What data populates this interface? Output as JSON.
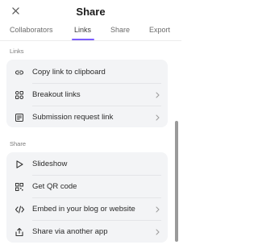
{
  "header": {
    "title": "Share",
    "close_icon": "close-icon"
  },
  "tabs": [
    {
      "label": "Collaborators",
      "active": false
    },
    {
      "label": "Links",
      "active": true
    },
    {
      "label": "Share",
      "active": false
    },
    {
      "label": "Export",
      "active": false
    }
  ],
  "accent_color": "#7c5cff",
  "links_section": {
    "label": "Links",
    "items": [
      {
        "label": "Copy link to clipboard",
        "icon": "link-icon",
        "has_chevron": false
      },
      {
        "label": "Breakout links",
        "icon": "breakout-grid-icon",
        "has_chevron": true
      },
      {
        "label": "Submission request link",
        "icon": "submission-form-icon",
        "has_chevron": true
      }
    ]
  },
  "share_section": {
    "label": "Share",
    "items": [
      {
        "label": "Slideshow",
        "icon": "play-icon",
        "has_chevron": false
      },
      {
        "label": "Get QR code",
        "icon": "qr-code-icon",
        "has_chevron": false
      },
      {
        "label": "Embed in your blog or website",
        "icon": "code-icon",
        "has_chevron": true
      },
      {
        "label": "Share via another app",
        "icon": "share-upload-icon",
        "has_chevron": true
      }
    ]
  }
}
